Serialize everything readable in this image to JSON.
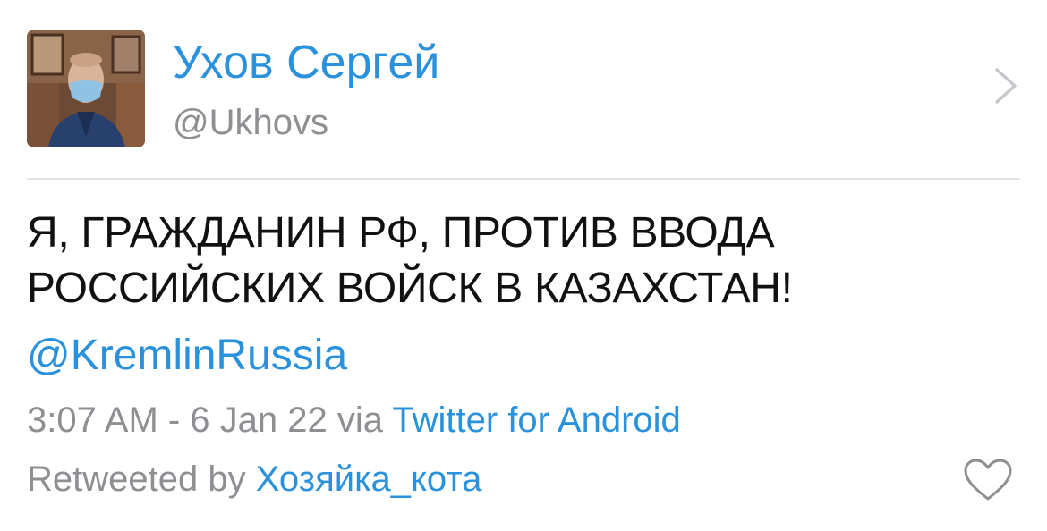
{
  "profile": {
    "display_name": "Ухов Сергей",
    "handle": "@Ukhovs",
    "avatar_icon": "avatar-photo",
    "chevron_icon": "chevron-right-icon"
  },
  "tweet": {
    "text_line_1": "Я, ГРАЖДАНИН РФ, ПРОТИВ ВВОДА",
    "text_line_2": "РОССИЙСКИХ ВОЙСК В КАЗАХСТАН!",
    "mention": "@KremlinRussia"
  },
  "meta": {
    "time": "3:07 AM - 6 Jan 22 via ",
    "source": "Twitter for Android"
  },
  "retweet": {
    "prefix": "Retweeted by ",
    "user": "Хозяйка_кота"
  },
  "actions": {
    "like_icon": "heart-icon"
  },
  "colors": {
    "link": "#2a92dc",
    "secondary_text": "#8e8e93",
    "primary_text": "#111111",
    "divider": "#e3e3e6"
  }
}
